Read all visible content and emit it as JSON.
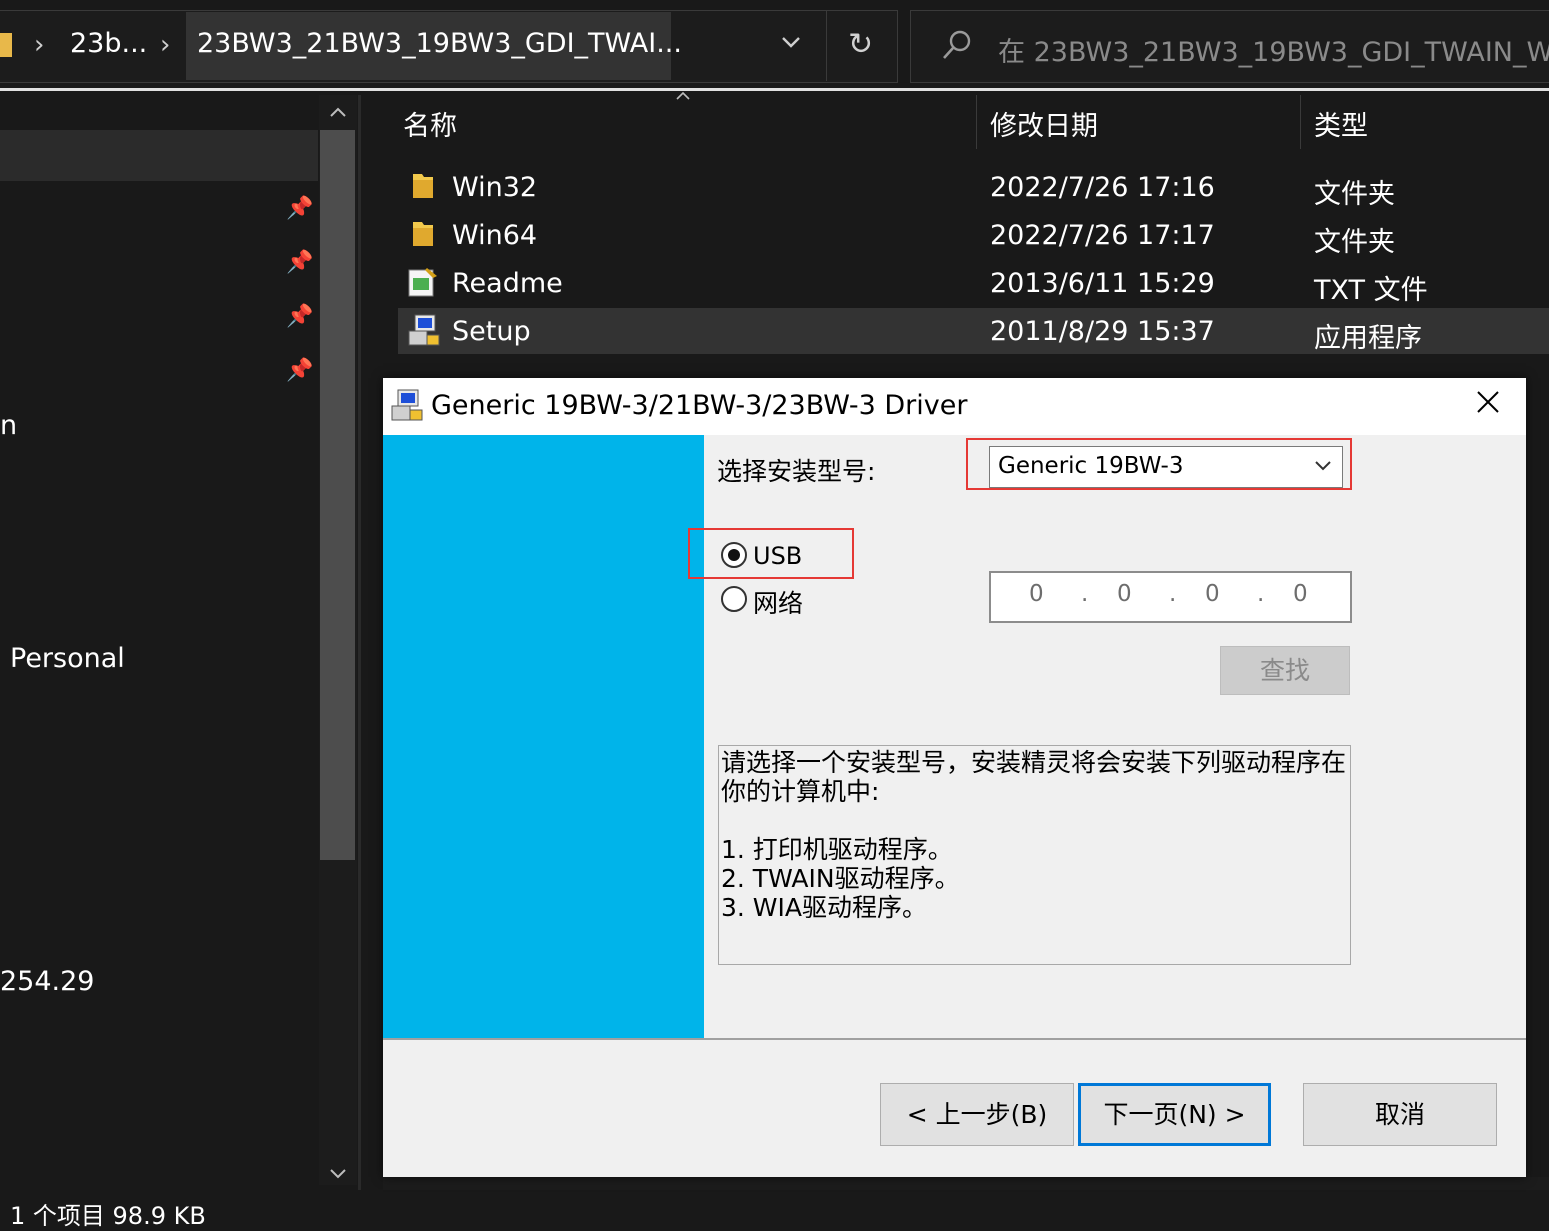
{
  "address_bar": {
    "crumbs": [
      "23b...",
      "23BW3_21BW3_19BW3_GDI_TWAI..."
    ],
    "search_placeholder": "在 23BW3_21BW3_19BW3_GDI_TWAIN_WIA"
  },
  "nav": {
    "visible_items": [
      "n",
      "Personal",
      "254.29"
    ]
  },
  "file_list": {
    "columns": [
      "名称",
      "修改日期",
      "类型"
    ],
    "rows": [
      {
        "name": "Win32",
        "date": "2022/7/26 17:16",
        "type": "文件夹",
        "icon": "folder-icon"
      },
      {
        "name": "Win64",
        "date": "2022/7/26 17:17",
        "type": "文件夹",
        "icon": "folder-icon"
      },
      {
        "name": "Readme",
        "date": "2013/6/11 15:29",
        "type": "TXT 文件",
        "icon": "text-file-icon"
      },
      {
        "name": "Setup",
        "date": "2011/8/29 15:37",
        "type": "应用程序",
        "icon": "installer-icon",
        "selected": true
      }
    ]
  },
  "status_bar": {
    "text": "1 个项目  98.9 KB"
  },
  "dialog": {
    "title": "Generic 19BW-3/21BW-3/23BW-3 Driver",
    "model_label": "选择安装型号:",
    "model_value": "Generic 19BW-3",
    "connection": {
      "usb_label": "USB",
      "network_label": "网络",
      "selected": "USB"
    },
    "ip_segments": [
      "0",
      "0",
      "0",
      "0"
    ],
    "find_button": "查找",
    "description": "请选择一个安装型号，安装精灵将会安装下列驱动程序在你的计算机中:\n\n1. 打印机驱动程序。\n2. TWAIN驱动程序。\n3. WIA驱动程序。",
    "buttons": {
      "back": "< 上一步(B)",
      "next": "下一页(N) >",
      "cancel": "取消"
    }
  },
  "colors": {
    "explorer_bg": "#191919",
    "dialog_side_panel": "#00b4ea",
    "highlight_box": "#e53935",
    "default_button_border": "#0078d7"
  }
}
